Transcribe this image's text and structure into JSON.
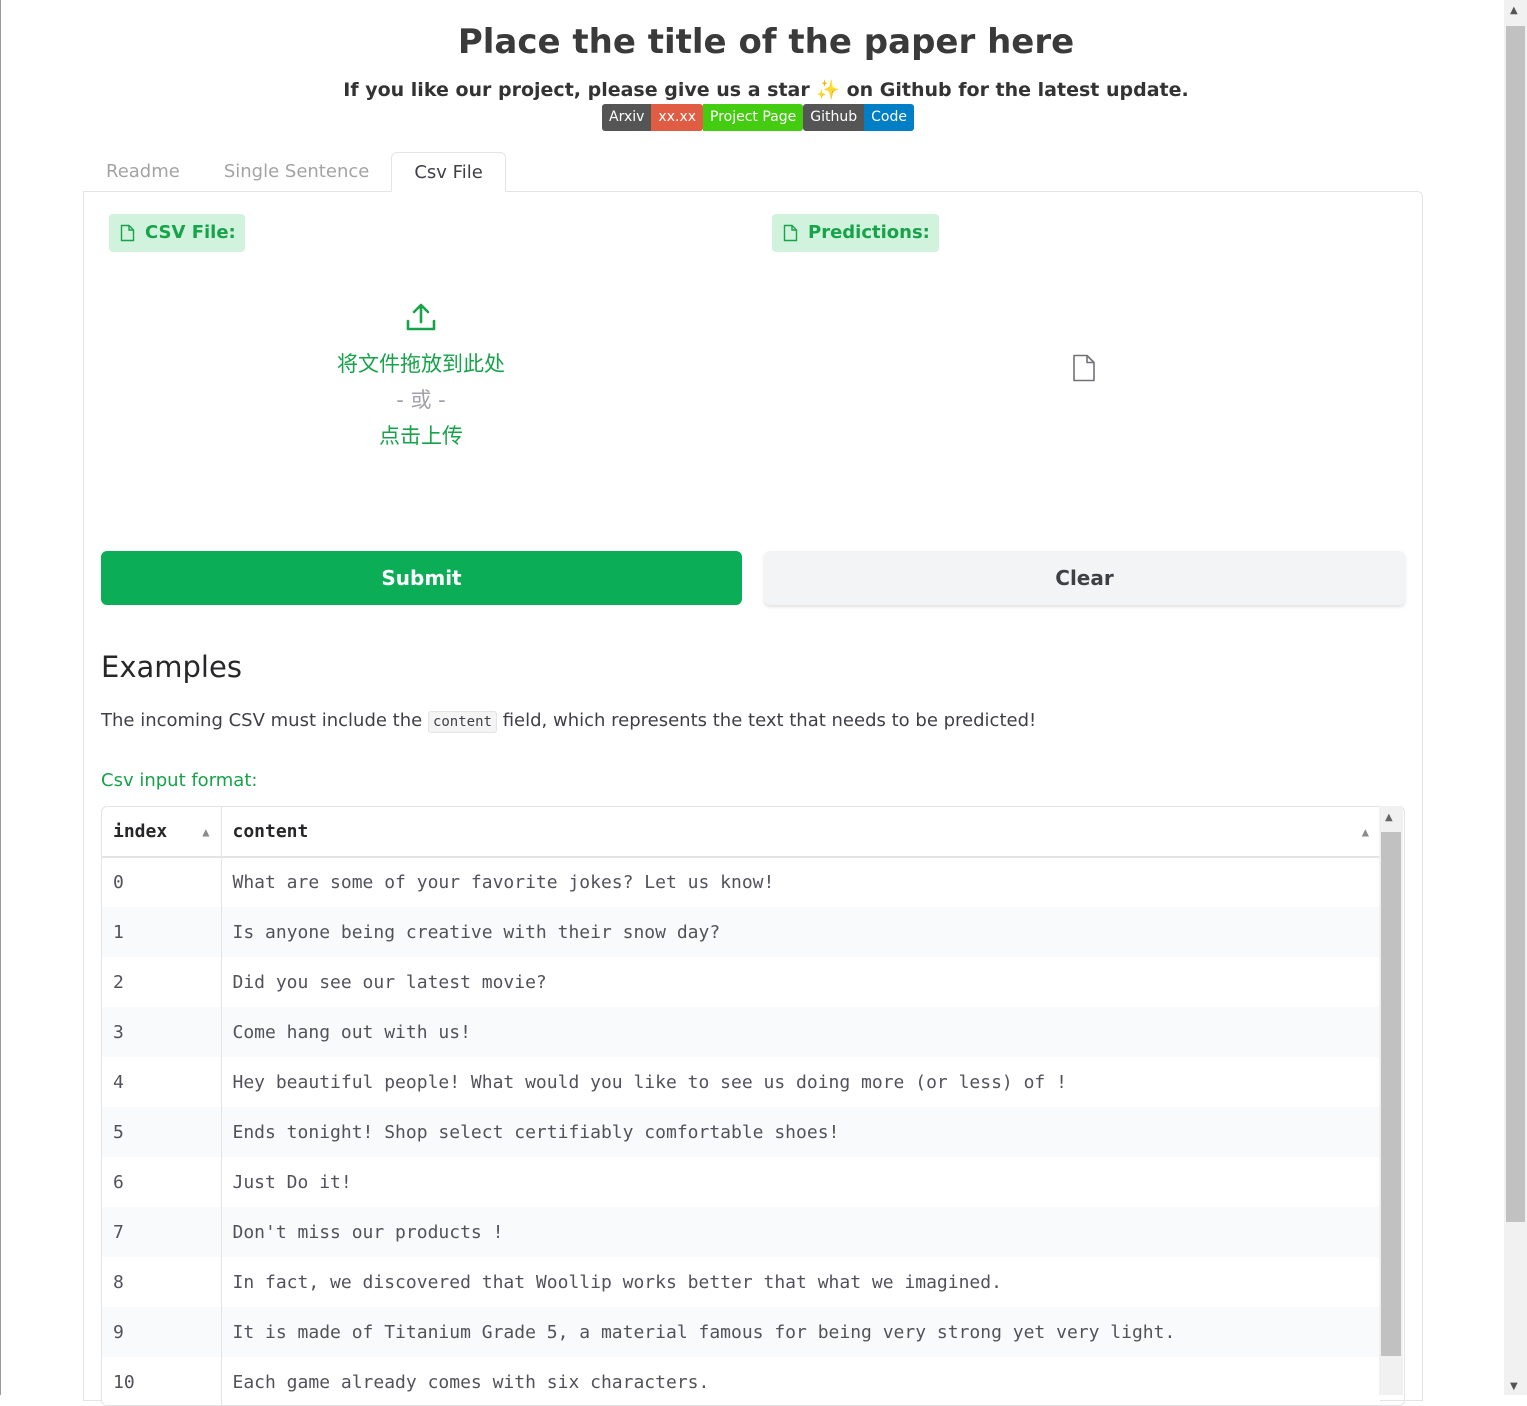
{
  "header": {
    "title": "Place the title of the paper here",
    "subtitle": "If you like our project, please give us a star ✨ on Github for the latest update.",
    "badges": [
      {
        "label": "Arxiv",
        "value": "xx.xx",
        "value_color": "#e05d44"
      },
      {
        "label": "Project Page",
        "color": "#44cc11"
      },
      {
        "label": "Github",
        "value": "Code",
        "value_color": "#007ec6"
      }
    ]
  },
  "tabs": [
    {
      "label": "Readme",
      "active": false
    },
    {
      "label": "Single Sentence",
      "active": false
    },
    {
      "label": "Csv File",
      "active": true
    }
  ],
  "input": {
    "label": "CSV File:",
    "drop_text": "将文件拖放到此处",
    "or_text": "- 或 -",
    "click_text": "点击上传"
  },
  "output": {
    "label": "Predictions:"
  },
  "buttons": {
    "submit": "Submit",
    "clear": "Clear"
  },
  "examples": {
    "heading": "Examples",
    "desc_before": "The incoming CSV must include the",
    "desc_code": "content",
    "desc_after": "field, which represents the text that needs to be predicted!",
    "format_label": "Csv input format:",
    "columns": [
      "index",
      "content"
    ],
    "rows": [
      [
        "0",
        "What are some of your favorite jokes? Let us know!"
      ],
      [
        "1",
        "Is anyone being creative with their snow day?"
      ],
      [
        "2",
        "Did you see our latest movie?"
      ],
      [
        "3",
        "Come hang out with us!"
      ],
      [
        "4",
        "Hey beautiful people! What would you like to see us doing more (or less) of !"
      ],
      [
        "5",
        "Ends tonight! Shop select certifiably comfortable shoes!"
      ],
      [
        "6",
        "Just Do it!"
      ],
      [
        "7",
        "Don't miss our products !"
      ],
      [
        "8",
        "In fact, we discovered that Woollip works better that what we imagined."
      ],
      [
        "9",
        "It is made of Titanium Grade 5, a material famous for being very strong yet very light."
      ],
      [
        "10",
        "Each game already comes with six characters."
      ]
    ]
  },
  "colors": {
    "accent": "#0bae57",
    "accent_text": "#16a34a",
    "label_bg": "#d1f2dd"
  }
}
